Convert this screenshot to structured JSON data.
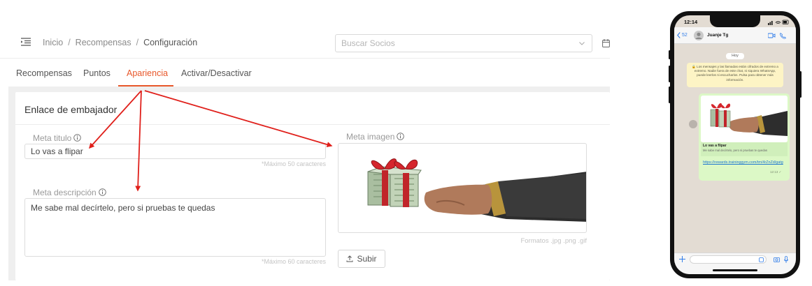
{
  "breadcrumb": {
    "items": [
      "Inicio",
      "Recompensas",
      "Configuración"
    ],
    "separator": "/"
  },
  "search": {
    "placeholder": "Buscar Socios",
    "value": ""
  },
  "tabs": [
    {
      "label": "Recompensas",
      "active": false
    },
    {
      "label": "Puntos",
      "active": false
    },
    {
      "label": "Apariencia",
      "active": true
    },
    {
      "label": "Activar/Desactivar",
      "active": false
    }
  ],
  "section": {
    "title": "Enlace de embajador",
    "meta_title": {
      "label": "Meta titulo",
      "value": "Lo vas a flipar",
      "hint": "*Máximo 50 caracteres"
    },
    "meta_description": {
      "label": "Meta descripción",
      "value": "Me sabe mal decírtelo, pero si pruebas te quedas",
      "hint": "*Máximo 60 caracteres"
    },
    "meta_image": {
      "label": "Meta imagen",
      "formats": "Formatos .jpg .png .gif",
      "upload_label": "Subir"
    }
  },
  "colors": {
    "accent": "#e8572a",
    "arrow": "#e0201b",
    "whatsapp_bubble": "#dcf8c6",
    "link": "#1f78d1"
  },
  "phone": {
    "time": "12:14",
    "back_count": "52",
    "contact": "Juanje Tg",
    "date_label": "Hoy",
    "encryption_notice": "🔒 Los mensajes y las llamadas están cifrados de extremo a extremo. Nadie fuera de este chat, ni siquiera WhatsApp, puede leerlos ni escucharlos. Pulsa para obtener más información.",
    "preview_title": "Lo vas a flipar",
    "preview_desc": "Me sabe mal decírtelo, pero si pruebas te quedas",
    "link": "https://rewards.traininggym.com/tm/4rZnZd/gatg",
    "msg_time": "12:13 ✓"
  }
}
